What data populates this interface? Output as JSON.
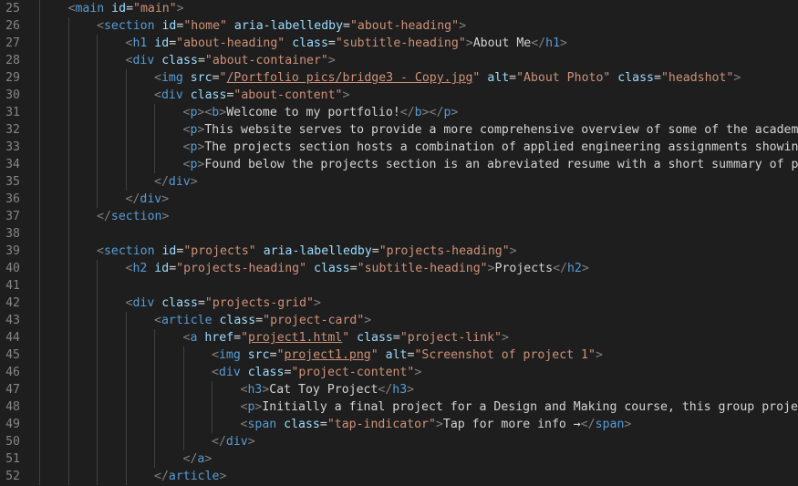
{
  "editor": {
    "colors": {
      "background": "#1e1e1e",
      "line_number": "#858585",
      "tag": "#569cd6",
      "attribute": "#9cdcfe",
      "string": "#ce9178",
      "text": "#d4d4d4",
      "bracket": "#808080"
    },
    "lines": [
      {
        "n": "25",
        "indent": 1,
        "tokens": [
          [
            "g",
            "<"
          ],
          [
            "t",
            "main"
          ],
          [
            "x",
            " "
          ],
          [
            "a",
            "id"
          ],
          [
            "x",
            "="
          ],
          [
            "s",
            "\"main\""
          ],
          [
            "g",
            ">"
          ]
        ]
      },
      {
        "n": "26",
        "indent": 2,
        "tokens": [
          [
            "g",
            "<"
          ],
          [
            "t",
            "section"
          ],
          [
            "x",
            " "
          ],
          [
            "a",
            "id"
          ],
          [
            "x",
            "="
          ],
          [
            "s",
            "\"home\""
          ],
          [
            "x",
            " "
          ],
          [
            "a",
            "aria-labelledby"
          ],
          [
            "x",
            "="
          ],
          [
            "s",
            "\"about-heading\""
          ],
          [
            "g",
            ">"
          ]
        ]
      },
      {
        "n": "27",
        "indent": 3,
        "tokens": [
          [
            "g",
            "<"
          ],
          [
            "t",
            "h1"
          ],
          [
            "x",
            " "
          ],
          [
            "a",
            "id"
          ],
          [
            "x",
            "="
          ],
          [
            "s",
            "\"about-heading\""
          ],
          [
            "x",
            " "
          ],
          [
            "a",
            "class"
          ],
          [
            "x",
            "="
          ],
          [
            "s",
            "\"subtitle-heading\""
          ],
          [
            "g",
            ">"
          ],
          [
            "x",
            "About Me"
          ],
          [
            "g",
            "</"
          ],
          [
            "t",
            "h1"
          ],
          [
            "g",
            ">"
          ]
        ]
      },
      {
        "n": "28",
        "indent": 3,
        "tokens": [
          [
            "g",
            "<"
          ],
          [
            "t",
            "div"
          ],
          [
            "x",
            " "
          ],
          [
            "a",
            "class"
          ],
          [
            "x",
            "="
          ],
          [
            "s",
            "\"about-container\""
          ],
          [
            "g",
            ">"
          ]
        ]
      },
      {
        "n": "29",
        "indent": 4,
        "tokens": [
          [
            "g",
            "<"
          ],
          [
            "t",
            "img"
          ],
          [
            "x",
            " "
          ],
          [
            "a",
            "src"
          ],
          [
            "x",
            "="
          ],
          [
            "s",
            "\""
          ],
          [
            "u",
            "/Portfolio pics/bridge3 - Copy.jpg"
          ],
          [
            "s",
            "\""
          ],
          [
            "x",
            " "
          ],
          [
            "a",
            "alt"
          ],
          [
            "x",
            "="
          ],
          [
            "s",
            "\"About Photo\""
          ],
          [
            "x",
            " "
          ],
          [
            "a",
            "class"
          ],
          [
            "x",
            "="
          ],
          [
            "s",
            "\"headshot\""
          ],
          [
            "g",
            ">"
          ]
        ]
      },
      {
        "n": "30",
        "indent": 4,
        "tokens": [
          [
            "g",
            "<"
          ],
          [
            "t",
            "div"
          ],
          [
            "x",
            " "
          ],
          [
            "a",
            "class"
          ],
          [
            "x",
            "="
          ],
          [
            "s",
            "\"about-content\""
          ],
          [
            "g",
            ">"
          ]
        ]
      },
      {
        "n": "31",
        "indent": 5,
        "tokens": [
          [
            "g",
            "<"
          ],
          [
            "t",
            "p"
          ],
          [
            "g",
            "><"
          ],
          [
            "t",
            "b"
          ],
          [
            "g",
            ">"
          ],
          [
            "x",
            "Welcome to my portfolio!"
          ],
          [
            "g",
            "</"
          ],
          [
            "t",
            "b"
          ],
          [
            "g",
            "></"
          ],
          [
            "t",
            "p"
          ],
          [
            "g",
            ">"
          ]
        ]
      },
      {
        "n": "32",
        "indent": 5,
        "tokens": [
          [
            "g",
            "<"
          ],
          [
            "t",
            "p"
          ],
          [
            "g",
            ">"
          ],
          [
            "x",
            "This website serves to provide a more comprehensive overview of some of the academic"
          ]
        ]
      },
      {
        "n": "33",
        "indent": 5,
        "tokens": [
          [
            "g",
            "<"
          ],
          [
            "t",
            "p"
          ],
          [
            "g",
            ">"
          ],
          [
            "x",
            "The projects section hosts a combination of applied engineering assignments showing p"
          ]
        ]
      },
      {
        "n": "34",
        "indent": 5,
        "tokens": [
          [
            "g",
            "<"
          ],
          [
            "t",
            "p"
          ],
          [
            "g",
            ">"
          ],
          [
            "x",
            "Found below the projects section is an abreviated resume with a short summary of prev"
          ]
        ]
      },
      {
        "n": "35",
        "indent": 4,
        "tokens": [
          [
            "g",
            "</"
          ],
          [
            "t",
            "div"
          ],
          [
            "g",
            ">"
          ]
        ]
      },
      {
        "n": "36",
        "indent": 3,
        "tokens": [
          [
            "g",
            "</"
          ],
          [
            "t",
            "div"
          ],
          [
            "g",
            ">"
          ]
        ]
      },
      {
        "n": "37",
        "indent": 2,
        "tokens": [
          [
            "g",
            "</"
          ],
          [
            "t",
            "section"
          ],
          [
            "g",
            ">"
          ]
        ]
      },
      {
        "n": "38",
        "indent": 0,
        "tokens": []
      },
      {
        "n": "39",
        "indent": 2,
        "tokens": [
          [
            "g",
            "<"
          ],
          [
            "t",
            "section"
          ],
          [
            "x",
            " "
          ],
          [
            "a",
            "id"
          ],
          [
            "x",
            "="
          ],
          [
            "s",
            "\"projects\""
          ],
          [
            "x",
            " "
          ],
          [
            "a",
            "aria-labelledby"
          ],
          [
            "x",
            "="
          ],
          [
            "s",
            "\"projects-heading\""
          ],
          [
            "g",
            ">"
          ]
        ]
      },
      {
        "n": "40",
        "indent": 3,
        "tokens": [
          [
            "g",
            "<"
          ],
          [
            "t",
            "h2"
          ],
          [
            "x",
            " "
          ],
          [
            "a",
            "id"
          ],
          [
            "x",
            "="
          ],
          [
            "s",
            "\"projects-heading\""
          ],
          [
            "x",
            " "
          ],
          [
            "a",
            "class"
          ],
          [
            "x",
            "="
          ],
          [
            "s",
            "\"subtitle-heading\""
          ],
          [
            "g",
            ">"
          ],
          [
            "x",
            "Projects"
          ],
          [
            "g",
            "</"
          ],
          [
            "t",
            "h2"
          ],
          [
            "g",
            ">"
          ]
        ]
      },
      {
        "n": "41",
        "indent": 0,
        "tokens": []
      },
      {
        "n": "42",
        "indent": 3,
        "tokens": [
          [
            "g",
            "<"
          ],
          [
            "t",
            "div"
          ],
          [
            "x",
            " "
          ],
          [
            "a",
            "class"
          ],
          [
            "x",
            "="
          ],
          [
            "s",
            "\"projects-grid\""
          ],
          [
            "g",
            ">"
          ]
        ]
      },
      {
        "n": "43",
        "indent": 4,
        "tokens": [
          [
            "g",
            "<"
          ],
          [
            "t",
            "article"
          ],
          [
            "x",
            " "
          ],
          [
            "a",
            "class"
          ],
          [
            "x",
            "="
          ],
          [
            "s",
            "\"project-card\""
          ],
          [
            "g",
            ">"
          ]
        ]
      },
      {
        "n": "44",
        "indent": 5,
        "tokens": [
          [
            "g",
            "<"
          ],
          [
            "t",
            "a"
          ],
          [
            "x",
            " "
          ],
          [
            "a",
            "href"
          ],
          [
            "x",
            "="
          ],
          [
            "s",
            "\""
          ],
          [
            "u",
            "project1.html"
          ],
          [
            "s",
            "\""
          ],
          [
            "x",
            " "
          ],
          [
            "a",
            "class"
          ],
          [
            "x",
            "="
          ],
          [
            "s",
            "\"project-link\""
          ],
          [
            "g",
            ">"
          ]
        ]
      },
      {
        "n": "45",
        "indent": 6,
        "tokens": [
          [
            "g",
            "<"
          ],
          [
            "t",
            "img"
          ],
          [
            "x",
            " "
          ],
          [
            "a",
            "src"
          ],
          [
            "x",
            "="
          ],
          [
            "s",
            "\""
          ],
          [
            "u",
            "project1.png"
          ],
          [
            "s",
            "\""
          ],
          [
            "x",
            " "
          ],
          [
            "a",
            "alt"
          ],
          [
            "x",
            "="
          ],
          [
            "s",
            "\"Screenshot of project 1\""
          ],
          [
            "g",
            ">"
          ]
        ]
      },
      {
        "n": "46",
        "indent": 6,
        "tokens": [
          [
            "g",
            "<"
          ],
          [
            "t",
            "div"
          ],
          [
            "x",
            " "
          ],
          [
            "a",
            "class"
          ],
          [
            "x",
            "="
          ],
          [
            "s",
            "\"project-content\""
          ],
          [
            "g",
            ">"
          ]
        ]
      },
      {
        "n": "47",
        "indent": 7,
        "tokens": [
          [
            "g",
            "<"
          ],
          [
            "t",
            "h3"
          ],
          [
            "g",
            ">"
          ],
          [
            "x",
            "Cat Toy Project"
          ],
          [
            "g",
            "</"
          ],
          [
            "t",
            "h3"
          ],
          [
            "g",
            ">"
          ]
        ]
      },
      {
        "n": "48",
        "indent": 7,
        "tokens": [
          [
            "g",
            "<"
          ],
          [
            "t",
            "p"
          ],
          [
            "g",
            ">"
          ],
          [
            "x",
            "Initially a final project for a Design and Making course, this group project"
          ]
        ]
      },
      {
        "n": "49",
        "indent": 7,
        "tokens": [
          [
            "g",
            "<"
          ],
          [
            "t",
            "span"
          ],
          [
            "x",
            " "
          ],
          [
            "a",
            "class"
          ],
          [
            "x",
            "="
          ],
          [
            "s",
            "\"tap-indicator\""
          ],
          [
            "g",
            ">"
          ],
          [
            "x",
            "Tap for more info →"
          ],
          [
            "g",
            "</"
          ],
          [
            "t",
            "span"
          ],
          [
            "g",
            ">"
          ]
        ]
      },
      {
        "n": "50",
        "indent": 6,
        "tokens": [
          [
            "g",
            "</"
          ],
          [
            "t",
            "div"
          ],
          [
            "g",
            ">"
          ]
        ]
      },
      {
        "n": "51",
        "indent": 5,
        "tokens": [
          [
            "g",
            "</"
          ],
          [
            "t",
            "a"
          ],
          [
            "g",
            ">"
          ]
        ]
      },
      {
        "n": "52",
        "indent": 4,
        "tokens": [
          [
            "g",
            "</"
          ],
          [
            "t",
            "article"
          ],
          [
            "g",
            ">"
          ]
        ]
      }
    ]
  }
}
